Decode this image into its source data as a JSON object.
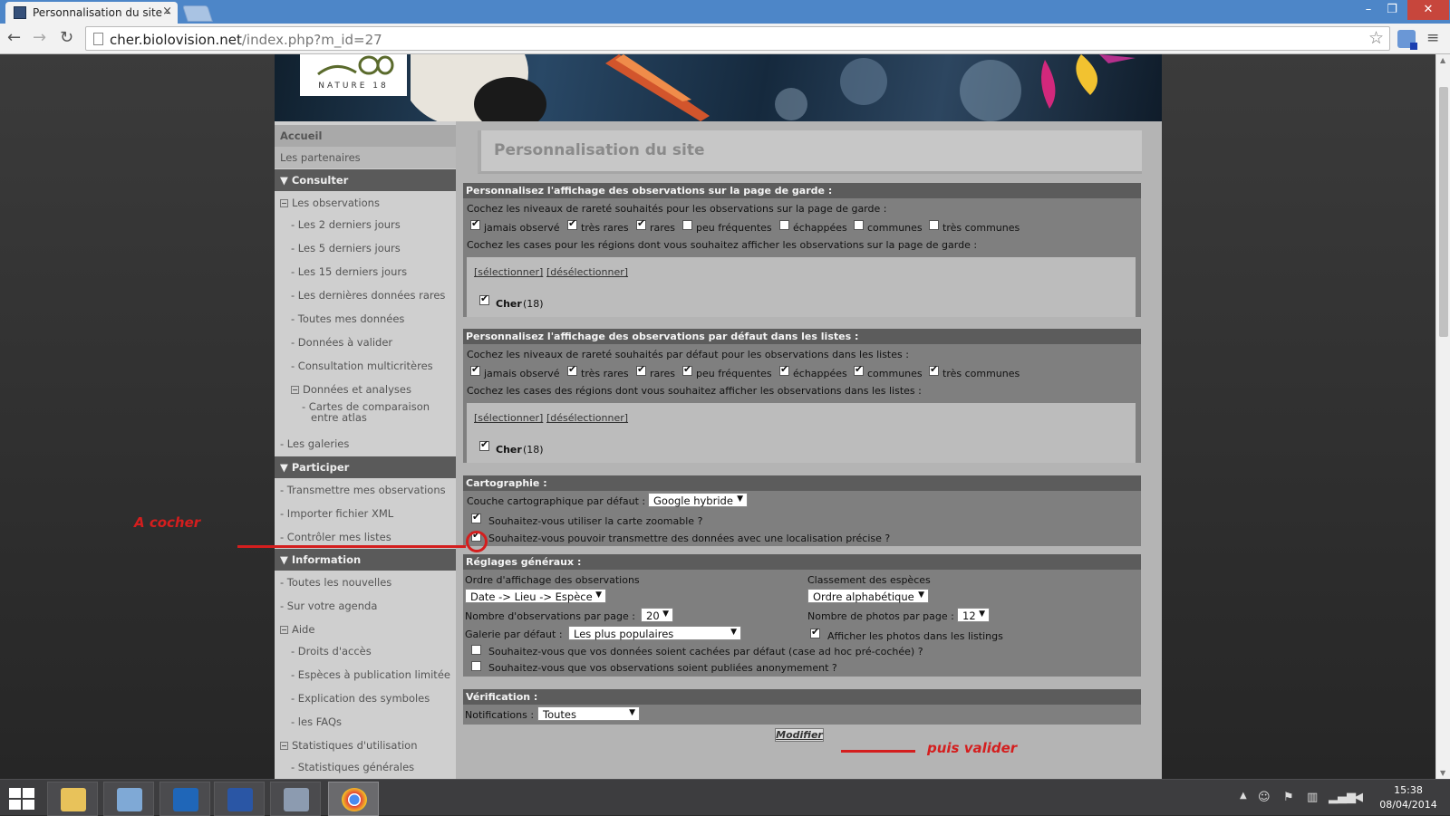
{
  "browser": {
    "tab_title": "Personnalisation du site -",
    "tab_close": "×",
    "url_host": "cher.biolovision.net",
    "url_path": "/index.php?m_id=27",
    "window_buttons": [
      "–",
      "❐",
      "✕"
    ],
    "back": "←",
    "forward": "→",
    "reload": "↻",
    "star": "☆",
    "menu": "≡"
  },
  "logo": {
    "text": "NATURE 18"
  },
  "nav": {
    "items": [
      {
        "label": "Accueil"
      },
      {
        "label": "Les partenaires"
      },
      {
        "label": "Consulter"
      },
      {
        "label": "Les observations"
      },
      {
        "label": "- Les 2 derniers jours"
      },
      {
        "label": "- Les 5 derniers jours"
      },
      {
        "label": "- Les 15 derniers jours"
      },
      {
        "label": "- Les dernières données rares"
      },
      {
        "label": "- Toutes mes données"
      },
      {
        "label": "- Données à valider"
      },
      {
        "label": "- Consultation multicritères"
      },
      {
        "label": "Données et analyses"
      },
      {
        "label": "- Cartes de comparaison"
      },
      {
        "label": "entre atlas"
      },
      {
        "label": "- Les galeries"
      },
      {
        "label": "Participer"
      },
      {
        "label": "- Transmettre mes observations"
      },
      {
        "label": "- Importer fichier XML"
      },
      {
        "label": "- Contrôler mes listes"
      },
      {
        "label": "Information"
      },
      {
        "label": "- Toutes les nouvelles"
      },
      {
        "label": "- Sur votre agenda"
      },
      {
        "label": "Aide"
      },
      {
        "label": "- Droits d'accès"
      },
      {
        "label": "- Espèces à publication limitée"
      },
      {
        "label": "- Explication des symboles"
      },
      {
        "label": "- les FAQs"
      },
      {
        "label": "Statistiques d'utilisation"
      },
      {
        "label": "- Statistiques générales"
      }
    ]
  },
  "page": {
    "title": "Personnalisation du site"
  },
  "section1": {
    "header": "Personnalisez l'affichage des observations sur la page de garde :",
    "rarity_prompt": "Cochez les niveaux de rareté souhaités pour les observations sur la page de garde :",
    "levels": [
      {
        "label": "jamais observé",
        "checked": true
      },
      {
        "label": "très rares",
        "checked": true
      },
      {
        "label": "rares",
        "checked": true
      },
      {
        "label": "peu fréquentes",
        "checked": false
      },
      {
        "label": "échappées",
        "checked": false
      },
      {
        "label": "communes",
        "checked": false
      },
      {
        "label": "très communes",
        "checked": false
      }
    ],
    "region_prompt": "Cochez les cases pour les régions dont vous souhaitez afficher les observations sur la page de garde :",
    "select_all": "[sélectionner]",
    "deselect_all": "[désélectionner]",
    "region_name": "Cher",
    "region_code": "(18)"
  },
  "section2": {
    "header": "Personnalisez l'affichage des observations par défaut dans les listes :",
    "rarity_prompt": "Cochez les niveaux de rareté souhaités par défaut pour les observations dans les listes :",
    "levels": [
      {
        "label": "jamais observé",
        "checked": true
      },
      {
        "label": "très rares",
        "checked": true
      },
      {
        "label": "rares",
        "checked": true
      },
      {
        "label": "peu fréquentes",
        "checked": true
      },
      {
        "label": "échappées",
        "checked": true
      },
      {
        "label": "communes",
        "checked": true
      },
      {
        "label": "très communes",
        "checked": true
      }
    ],
    "region_prompt": "Cochez les cases des régions dont vous souhaitez afficher les observations dans les listes :",
    "select_all": "[sélectionner]",
    "deselect_all": "[désélectionner]",
    "region_name": "Cher",
    "region_code": "(18)"
  },
  "cartography": {
    "header": "Cartographie :",
    "layer_label": "Couche cartographique par défaut :",
    "layer_value": "Google hybride",
    "zoom_label": "Souhaitez-vous utiliser la carte zoomable ?",
    "precise_label": "Souhaitez-vous pouvoir transmettre des données avec une localisation précise ?"
  },
  "general": {
    "header": "Réglages généraux :",
    "order_label": "Ordre d'affichage des observations",
    "order_value": "Date -> Lieu -> Espèce",
    "species_label": "Classement des espèces",
    "species_value": "Ordre alphabétique",
    "obs_per_page_label": "Nombre d'observations par page :",
    "obs_per_page_value": "20",
    "photos_per_page_label": "Nombre de photos par page :",
    "photos_per_page_value": "12",
    "gallery_label": "Galerie par défaut :",
    "gallery_value": "Les plus populaires",
    "show_photos_label": "Afficher les photos dans les listings",
    "hidden_label": "Souhaitez-vous que vos données soient cachées par défaut (case ad hoc pré-cochée) ?",
    "anon_label": "Souhaitez-vous que vos observations soient publiées anonymement ?"
  },
  "verification": {
    "header": "Vérification :",
    "notif_label": "Notifications :",
    "notif_value": "Toutes"
  },
  "submit": {
    "label": "Modifier"
  },
  "annotations": {
    "check": "A cocher",
    "validate": "puis valider",
    "color": "#d41e1e"
  },
  "taskbar": {
    "time": "15:38",
    "date": "08/04/2014"
  }
}
